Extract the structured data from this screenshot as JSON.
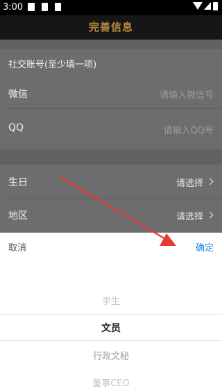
{
  "status_bar": {
    "time": "3:00"
  },
  "header": {
    "title": "完善信息"
  },
  "form": {
    "social_section_label": "社交账号(至少填一项)",
    "wechat": {
      "label": "微信",
      "placeholder": "请输入微信号"
    },
    "qq": {
      "label": "QQ",
      "placeholder": "请输入QQ号"
    },
    "birthday": {
      "label": "生日",
      "value": "请选择"
    },
    "region": {
      "label": "地区",
      "value": "请选择"
    }
  },
  "picker": {
    "cancel_label": "取消",
    "confirm_label": "确定",
    "options": [
      "学生",
      "文员",
      "行政文秘",
      "董事CEO"
    ],
    "selected": "文员"
  },
  "colors": {
    "title": "#b78a3c",
    "confirm": "#1e88e5",
    "arrow": "#e53935"
  },
  "icons": [
    "image-icon",
    "notification-icon",
    "app-icon",
    "wifi-icon",
    "cell-signal-icon",
    "battery-icon",
    "chevron-right-icon"
  ]
}
